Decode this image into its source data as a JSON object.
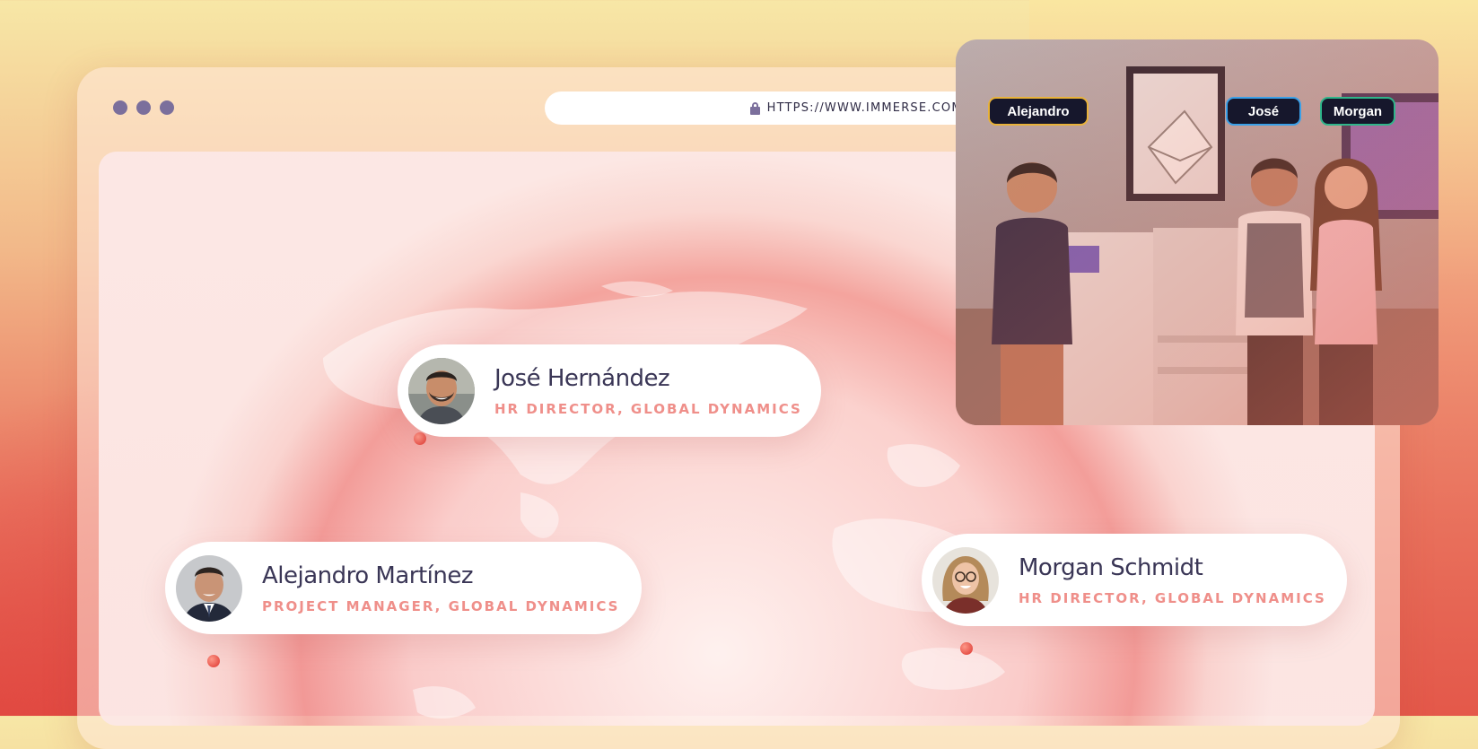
{
  "browser": {
    "url": "HTTPS://WWW.IMMERSE.COM/",
    "window_controls": [
      "dot",
      "dot",
      "dot"
    ]
  },
  "cards": [
    {
      "name": "José Hernández",
      "role": "HR DIRECTOR, GLOBAL DYNAMICS"
    },
    {
      "name": "Alejandro Martínez",
      "role": "PROJECT MANAGER, GLOBAL DYNAMICS"
    },
    {
      "name": "Morgan Schmidt",
      "role": "HR DIRECTOR, GLOBAL DYNAMICS"
    }
  ],
  "video": {
    "participants": [
      {
        "label": "Alejandro",
        "border": "#e8b23a"
      },
      {
        "label": "José",
        "border": "#3aa0e8"
      },
      {
        "label": "Morgan",
        "border": "#2fb58a"
      }
    ]
  },
  "colors": {
    "accent": "#ef8f8a",
    "name_text": "#3a3656",
    "dots": "#7b6f9c"
  }
}
